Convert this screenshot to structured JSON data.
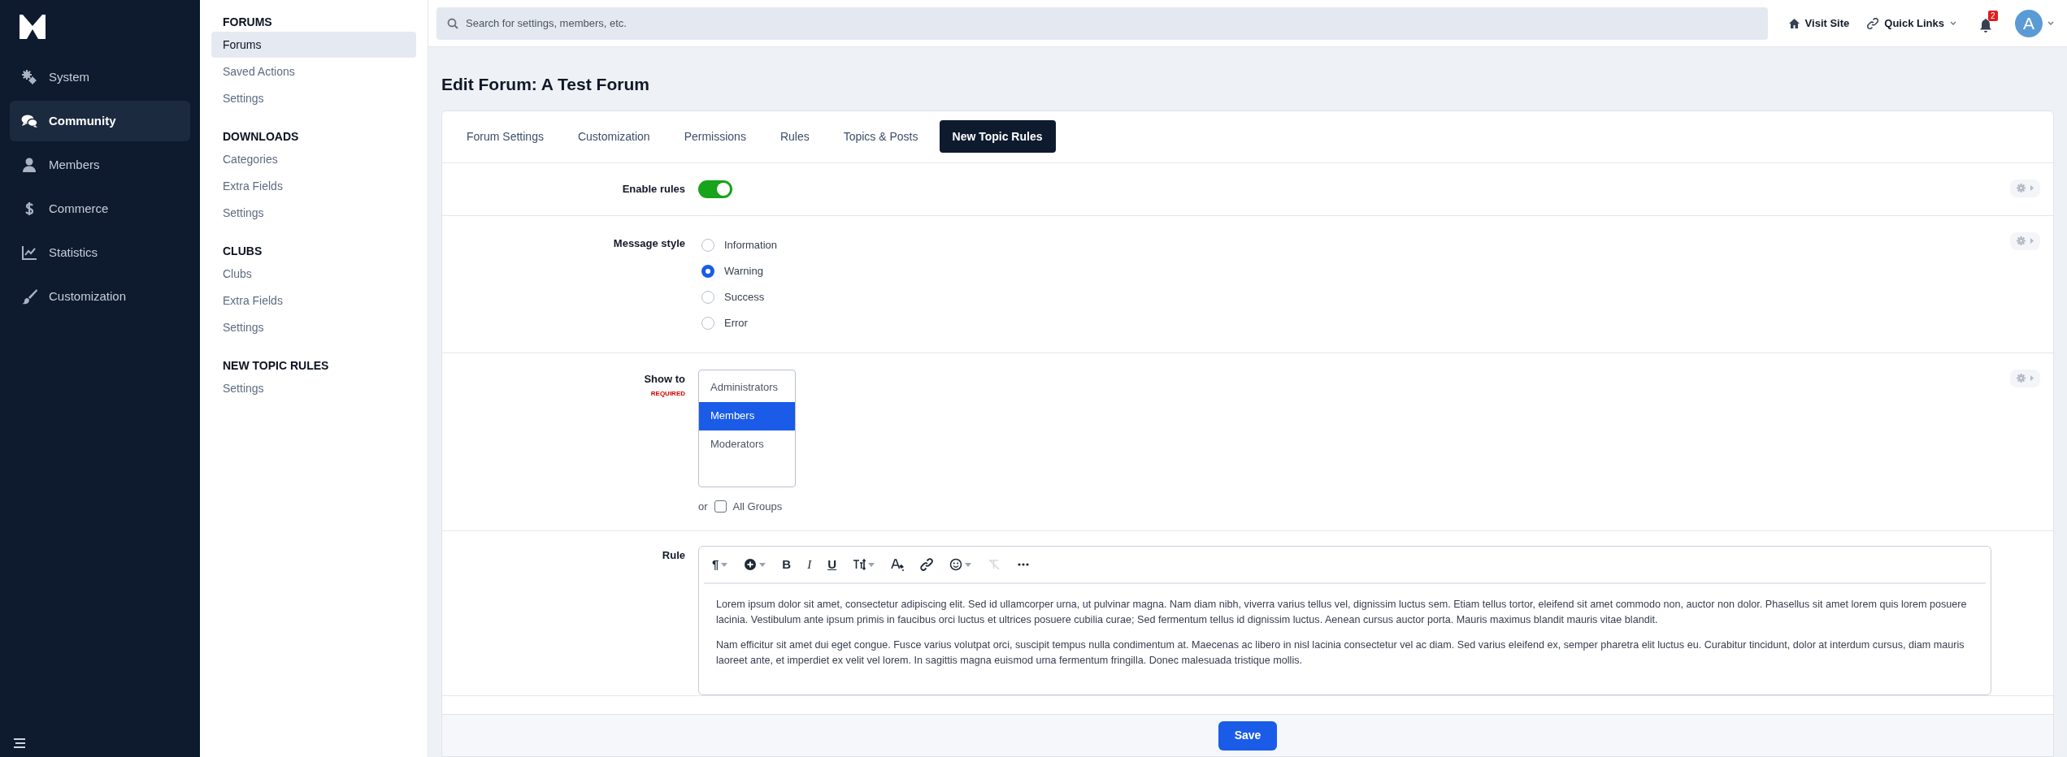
{
  "sidebar": {
    "items": [
      {
        "label": "System",
        "selected": false
      },
      {
        "label": "Community",
        "selected": true
      },
      {
        "label": "Members",
        "selected": false
      },
      {
        "label": "Commerce",
        "selected": false
      },
      {
        "label": "Statistics",
        "selected": false
      },
      {
        "label": "Customization",
        "selected": false
      }
    ]
  },
  "subnav": {
    "sections": [
      {
        "heading": "FORUMS",
        "items": [
          {
            "label": "Forums",
            "selected": true
          },
          {
            "label": "Saved Actions",
            "selected": false
          },
          {
            "label": "Settings",
            "selected": false
          }
        ]
      },
      {
        "heading": "DOWNLOADS",
        "items": [
          {
            "label": "Categories",
            "selected": false
          },
          {
            "label": "Extra Fields",
            "selected": false
          },
          {
            "label": "Settings",
            "selected": false
          }
        ]
      },
      {
        "heading": "CLUBS",
        "items": [
          {
            "label": "Clubs",
            "selected": false
          },
          {
            "label": "Extra Fields",
            "selected": false
          },
          {
            "label": "Settings",
            "selected": false
          }
        ]
      },
      {
        "heading": "NEW TOPIC RULES",
        "items": [
          {
            "label": "Settings",
            "selected": false
          }
        ]
      }
    ]
  },
  "topbar": {
    "search": {
      "placeholder": "Search for settings, members, etc."
    },
    "visit_site": "Visit Site",
    "quick_links": "Quick Links",
    "notification_count": "2",
    "avatar": "A"
  },
  "page_title": "Edit Forum: A Test Forum",
  "tabs": [
    {
      "label": "Forum Settings",
      "selected": false
    },
    {
      "label": "Customization",
      "selected": false
    },
    {
      "label": "Permissions",
      "selected": false
    },
    {
      "label": "Rules",
      "selected": false
    },
    {
      "label": "Topics & Posts",
      "selected": false
    },
    {
      "label": "New Topic Rules",
      "selected": true
    }
  ],
  "fields": [
    {
      "kind": "toggle",
      "label": "Enable rules",
      "on": true,
      "has_menu": true
    },
    {
      "kind": "radio",
      "label": "Message style",
      "has_menu": true,
      "options": [
        {
          "label": "Information",
          "selected": false
        },
        {
          "label": "Warning",
          "selected": true
        },
        {
          "label": "Success",
          "selected": false
        },
        {
          "label": "Error",
          "selected": false
        }
      ]
    },
    {
      "kind": "multiselect",
      "label": "Show to",
      "required": "REQUIRED",
      "has_menu": true,
      "options": [
        {
          "label": "Administrators",
          "selected": false
        },
        {
          "label": "Members",
          "selected": true
        },
        {
          "label": "Moderators",
          "selected": false
        }
      ],
      "or": "or",
      "all_groups": {
        "label": "All Groups",
        "checked": false
      }
    },
    {
      "kind": "editor",
      "label": "Rule",
      "has_menu": false,
      "toolbar": [
        {
          "kind": "paragraph",
          "glyph": "¶",
          "dropdown": true,
          "disabled": false
        },
        {
          "kind": "insert",
          "dropdown": true,
          "disabled": false
        },
        {
          "kind": "bold",
          "glyph": "B",
          "dropdown": false,
          "disabled": false
        },
        {
          "kind": "italic",
          "glyph": "I",
          "dropdown": false,
          "disabled": false
        },
        {
          "kind": "underline",
          "glyph": "U",
          "dropdown": false,
          "disabled": false
        },
        {
          "kind": "textsize",
          "dropdown": true,
          "disabled": false
        },
        {
          "kind": "color",
          "dropdown": false,
          "disabled": false
        },
        {
          "kind": "link",
          "dropdown": false,
          "disabled": false
        },
        {
          "kind": "emoji",
          "dropdown": true,
          "disabled": false
        },
        {
          "kind": "clear",
          "dropdown": false,
          "disabled": true
        },
        {
          "kind": "more",
          "dropdown": false,
          "disabled": false
        }
      ],
      "paragraphs": [
        "Lorem ipsum dolor sit amet, consectetur adipiscing elit. Sed id ullamcorper urna, ut pulvinar magna. Nam diam nibh, viverra varius tellus vel, dignissim luctus sem. Etiam tellus tortor, eleifend sit amet commodo non, auctor non dolor. Phasellus sit amet lorem quis lorem posuere lacinia. Vestibulum ante ipsum primis in faucibus orci luctus et ultrices posuere cubilia curae; Sed fermentum tellus id dignissim luctus. Aenean cursus auctor porta. Mauris maximus blandit mauris vitae blandit.",
        "Nam efficitur sit amet dui eget congue. Fusce varius volutpat orci, suscipit tempus nulla condimentum at. Maecenas ac libero in nisl lacinia consectetur vel ac diam. Sed varius eleifend ex, semper pharetra elit luctus eu. Curabitur tincidunt, dolor at interdum cursus, diam mauris laoreet ante, et imperdiet ex velit vel lorem. In sagittis magna euismod urna fermentum fringilla. Donec malesuada tristique mollis."
      ]
    }
  ],
  "save_button": "Save"
}
